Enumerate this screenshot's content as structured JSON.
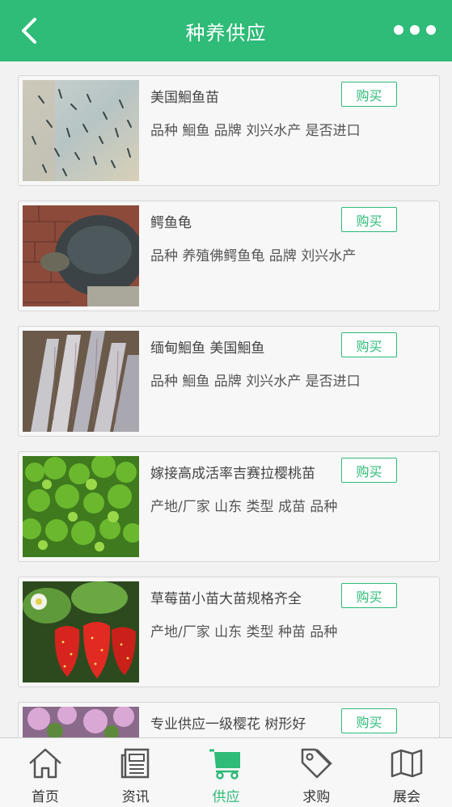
{
  "header": {
    "title": "种养供应",
    "back_icon": "chevron-left-icon",
    "more_icon": "more-dots-icon"
  },
  "colors": {
    "accent": "#2fbb78",
    "background": "#f2f2f2"
  },
  "products": [
    {
      "name": "美国鮰鱼苗",
      "desc": "品种 鮰鱼 品牌 刘兴水产 是否进口",
      "buy": "购买",
      "image": "fish-fry-photo"
    },
    {
      "name": "鳄鱼龟",
      "desc": "品种 养殖佛鳄鱼龟 品牌 刘兴水产",
      "buy": "购买",
      "image": "snapping-turtle-photo"
    },
    {
      "name": "缅甸鮰鱼 美国鮰鱼",
      "desc": "品种 鮰鱼 品牌 刘兴水产 是否进口",
      "buy": "购买",
      "image": "catfish-photo"
    },
    {
      "name": "嫁接高成活率吉赛拉樱桃苗",
      "desc": "产地/厂家 山东 类型 成苗 品种",
      "buy": "购买",
      "image": "cherry-seedlings-photo"
    },
    {
      "name": "草莓苗小苗大苗规格齐全",
      "desc": "产地/厂家 山东 类型 种苗 品种",
      "buy": "购买",
      "image": "strawberry-photo"
    },
    {
      "name": "专业供应一级樱花 树形好",
      "desc": "",
      "buy": "购买",
      "image": "cherry-blossom-photo"
    }
  ],
  "nav": [
    {
      "label": "首页",
      "icon": "home-icon",
      "active": false
    },
    {
      "label": "资讯",
      "icon": "news-icon",
      "active": false
    },
    {
      "label": "供应",
      "icon": "cart-icon",
      "active": true
    },
    {
      "label": "求购",
      "icon": "tag-icon",
      "active": false
    },
    {
      "label": "展会",
      "icon": "map-icon",
      "active": false
    }
  ]
}
